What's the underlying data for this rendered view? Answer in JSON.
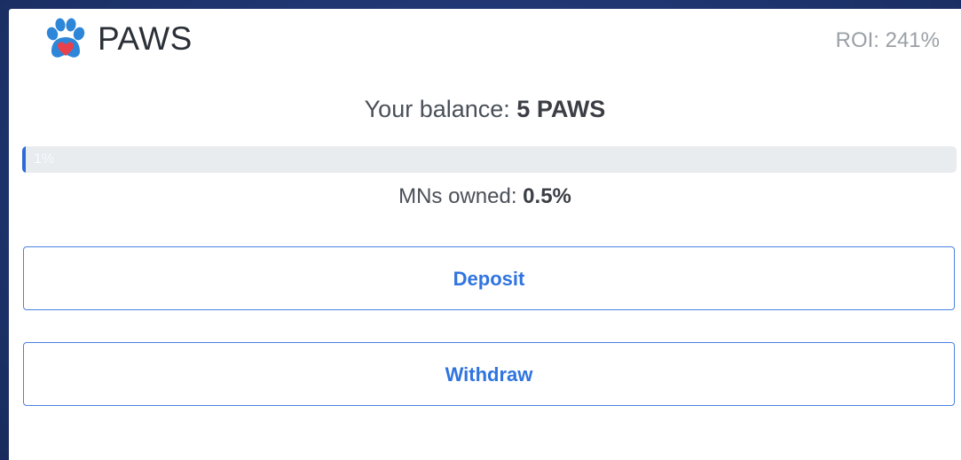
{
  "header": {
    "brand": "PAWS",
    "logo_icon": "paw-heart-icon",
    "roi_label": "ROI: 241%"
  },
  "balance": {
    "label": "Your balance: ",
    "value": "5 PAWS"
  },
  "progress": {
    "label": "1%",
    "value_percent": 1,
    "fill_color": "#2d6bd8"
  },
  "mns": {
    "label": "MNs owned: ",
    "value": "0.5%"
  },
  "actions": {
    "deposit_label": "Deposit",
    "withdraw_label": "Withdraw"
  },
  "colors": {
    "accent": "#2f74df",
    "background": "#1f3670",
    "logo_blue": "#2e86d8",
    "logo_heart": "#e8414b"
  }
}
